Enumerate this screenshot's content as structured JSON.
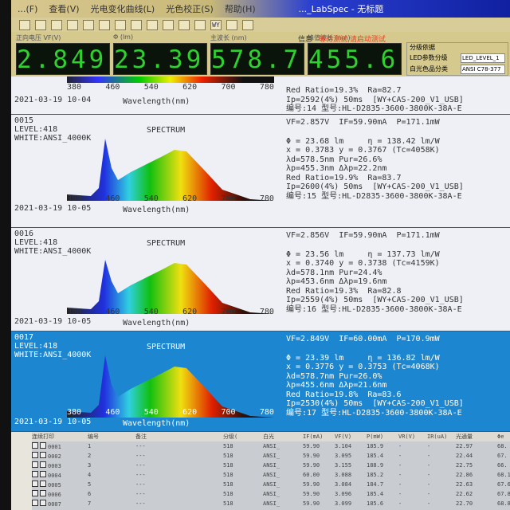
{
  "window": {
    "title": "..._LabSpec - 无标题",
    "menu": [
      "...(F)",
      "查看(V)",
      "光电变化曲线(L)",
      "光色校正(S)",
      "帮助(H)"
    ]
  },
  "toolbar": [
    "new",
    "open",
    "save",
    "connect",
    "x1",
    "color",
    "bar1",
    "bar2",
    "img1",
    "img2",
    "doc",
    "img3",
    "WY",
    "bulb",
    "info"
  ],
  "readouts": [
    {
      "label": "正向电压 VF(V)",
      "value": "2.849"
    },
    {
      "label": "Φ (lm)",
      "value": "23.39"
    },
    {
      "label": "主波长 (nm)",
      "value": "578.7"
    },
    {
      "label": "峰值波长 (nm)",
      "value": "455.6"
    }
  ],
  "info": {
    "label": "信息",
    "status": "等待测试,请启动测试"
  },
  "grading": {
    "title": "分级依据",
    "led_label": "LED参数分级",
    "led_value": "LED_LEVEL_1",
    "white_label": "白光色品分类",
    "white_value": "ANSI C78-377"
  },
  "partial_record": {
    "line1": "Red Ratio=19.3%  Ra=82.7",
    "line2": "Ip=2592(4%) 50ms  [WY+CAS-200_V1_USB]",
    "line3": "编号:14 型号:HL-D2835-3600-3800K-38A-E",
    "date": "2021-03-19 10-04",
    "axis": [
      "380",
      "460",
      "540",
      "620",
      "700",
      "780"
    ],
    "wl": "Wavelength(nm)"
  },
  "spectrum_title": "SPECTRUM",
  "axis_ticks": [
    "380",
    "460",
    "540",
    "620",
    "700",
    "780"
  ],
  "wavelength_label": "Wavelength(nm)",
  "records": [
    {
      "no": "0015",
      "level": "LEVEL:418",
      "white": "WHITE:ANSI_4000K",
      "date": "2021-03-19 10-05",
      "vf": "VF=2.857V  IF=59.90mA  P=171.1mW",
      "phi": "Φ = 23.68 lm     η = 138.42 lm/W",
      "xy": "x = 0.3783 y = 0.3767 (Tc=4058K)",
      "ld": "λd=578.5nm Pur=26.6%",
      "lp": "λp=455.3nm Δλp=22.2nm",
      "rr": "Red Ratio=19.9%  Ra=83.7",
      "ip": "Ip=2600(4%) 50ms  [WY+CAS-200_V1_USB]",
      "model": "编号:15 型号:HL-D2835-3600-3800K-38A-E"
    },
    {
      "no": "0016",
      "level": "LEVEL:418",
      "white": "WHITE:ANSI_4000K",
      "date": "2021-03-19 10-05",
      "vf": "VF=2.856V  IF=59.90mA  P=171.1mW",
      "phi": "Φ = 23.56 lm     η = 137.73 lm/W",
      "xy": "x = 0.3740 y = 0.3738 (Tc=4159K)",
      "ld": "λd=578.1nm Pur=24.4%",
      "lp": "λp=453.6nm Δλp=19.6nm",
      "rr": "Red Ratio=19.3%  Ra=82.8",
      "ip": "Ip=2559(4%) 50ms  [WY+CAS-200_V1_USB]",
      "model": "编号:16 型号:HL-D2835-3600-3800K-38A-E"
    },
    {
      "no": "0017",
      "level": "LEVEL:418",
      "white": "WHITE:ANSI_4000K",
      "date": "2021-03-19 10-05",
      "vf": "VF=2.849V  IF=60.00mA  P=170.9mW",
      "phi": "Φ = 23.39 lm     η = 136.82 lm/W",
      "xy": "x = 0.3776 y = 0.3753 (Tc=4068K)",
      "ld": "λd=578.7nm Pur=26.0%",
      "lp": "λp=455.6nm Δλp=21.6nm",
      "rr": "Red Ratio=19.8%  Ra=83.6",
      "ip": "Ip=2530(4%) 50ms  [WY+CAS-200_V1_USB]",
      "model": "编号:17 型号:HL-D2835-3600-3800K-38A-E"
    }
  ],
  "table": {
    "headers": [
      "连续打印",
      "编号",
      "备注",
      "分级(",
      "白光",
      "IF(mA)",
      "VF(V)",
      "P(mW)",
      "VR(V)",
      "IR(uA)",
      "光通量",
      "Φe"
    ],
    "rows": [
      [
        "0001",
        "1",
        "---",
        "518",
        "ANSI_",
        "59.90",
        "3.104",
        "185.9",
        "-",
        "-",
        "22.97",
        "68."
      ],
      [
        "0002",
        "2",
        "---",
        "518",
        "ANSI_",
        "59.90",
        "3.095",
        "185.4",
        "-",
        "-",
        "22.44",
        "67."
      ],
      [
        "0003",
        "3",
        "---",
        "518",
        "ANSI_",
        "59.90",
        "3.155",
        "188.9",
        "-",
        "-",
        "22.75",
        "66."
      ],
      [
        "0004",
        "4",
        "---",
        "518",
        "ANSI_",
        "60.00",
        "3.088",
        "185.2",
        "-",
        "-",
        "22.86",
        "68.1"
      ],
      [
        "0005",
        "5",
        "---",
        "518",
        "ANSI_",
        "59.90",
        "3.084",
        "184.7",
        "-",
        "-",
        "22.63",
        "67.6"
      ],
      [
        "0006",
        "6",
        "---",
        "518",
        "ANSI_",
        "59.90",
        "3.096",
        "185.4",
        "-",
        "-",
        "22.62",
        "67.8"
      ],
      [
        "0007",
        "7",
        "---",
        "518",
        "ANSI_",
        "59.90",
        "3.099",
        "185.6",
        "-",
        "-",
        "22.70",
        "68.8"
      ]
    ]
  }
}
